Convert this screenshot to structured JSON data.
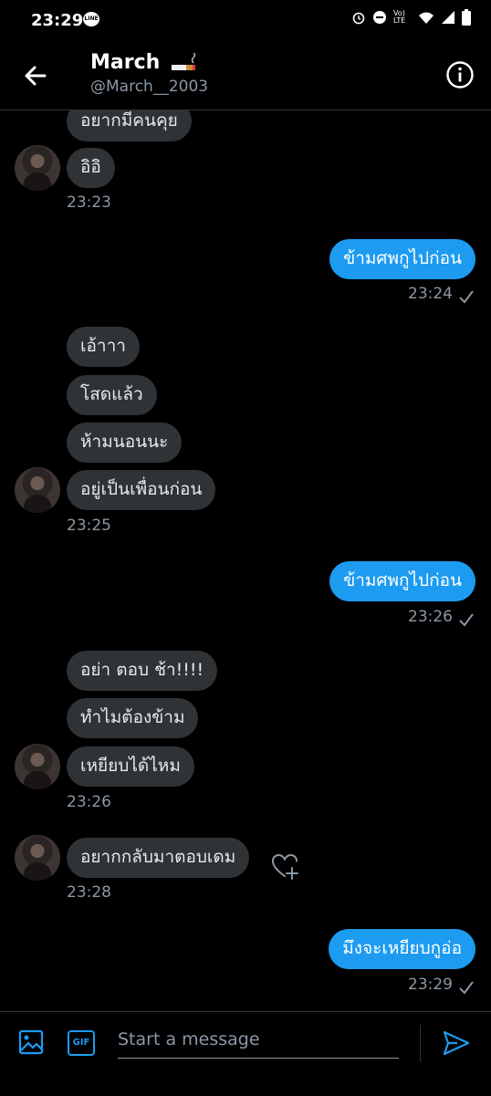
{
  "status_bar": {
    "time": "23:29",
    "app_badge": "LINE",
    "volte": "Vo) LTE"
  },
  "header": {
    "name": "March",
    "handle": "@March__2003"
  },
  "messages": {
    "m1": "อยากมีคนคุย",
    "m2": "อิอิ",
    "t1": "23:23",
    "m3": "ข้ามศพกูไปก่อน",
    "t2": "23:24",
    "m4": "เอ้าาา",
    "m5": "โสดแล้ว",
    "m6": "ห้ามนอนนะ",
    "m7": "อยู่เป็นเพื่อนก่อน",
    "t3": "23:25",
    "m8": "ข้ามศพกูไปก่อน",
    "t4": "23:26",
    "m9": "อย่า ตอบ ช้า!!!!",
    "m10": "ทำไมต้องข้าม",
    "m11": "เหยียบได้ไหม",
    "t5": "23:26",
    "m12": "อยากกลับมาตอบเดม",
    "t6": "23:28",
    "m13": "มึงจะเหยียบกูอ่อ",
    "t7": "23:29"
  },
  "composer": {
    "placeholder": "Start a message",
    "gif_label": "GIF"
  },
  "colors": {
    "accent": "#1d9bf0",
    "incoming_bubble": "#2f3336",
    "muted": "#8b98a5"
  }
}
